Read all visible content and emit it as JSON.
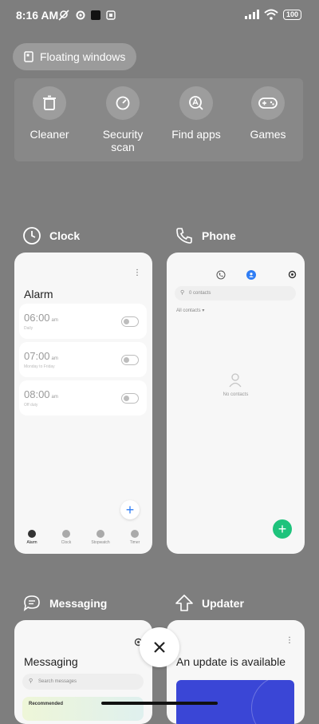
{
  "status_bar": {
    "time": "8:16 AM",
    "battery": "100"
  },
  "floating_windows": {
    "label": "Floating windows"
  },
  "shortcuts": [
    {
      "label": "Cleaner",
      "icon": "trash-icon"
    },
    {
      "label": "Security scan",
      "icon": "speedometer-icon"
    },
    {
      "label": "Find apps",
      "icon": "search-app-icon"
    },
    {
      "label": "Games",
      "icon": "gamepad-icon"
    }
  ],
  "apps": {
    "clock": {
      "name": "Clock",
      "screen_title": "Alarm",
      "alarms": [
        {
          "time": "06:00",
          "ampm": "am",
          "sub": "Daily"
        },
        {
          "time": "07:00",
          "ampm": "am",
          "sub": "Monday to Friday"
        },
        {
          "time": "08:00",
          "ampm": "am",
          "sub": "Off duty"
        }
      ],
      "tabs": [
        "Alarm",
        "Clock",
        "Stopwatch",
        "Timer"
      ]
    },
    "phone": {
      "name": "Phone",
      "search_placeholder": "0 contacts",
      "all_contacts": "All contacts",
      "empty": "No contacts"
    },
    "messaging": {
      "name": "Messaging",
      "screen_title": "Messaging",
      "search_placeholder": "Search messages",
      "recommended": "Recommended"
    },
    "updater": {
      "name": "Updater",
      "screen_title": "An update is available"
    }
  },
  "colors": {
    "backdrop": "#7e7e7e",
    "accent_blue": "#2f7df4",
    "accent_green": "#1ec37c",
    "update_banner": "#3a46d6"
  }
}
